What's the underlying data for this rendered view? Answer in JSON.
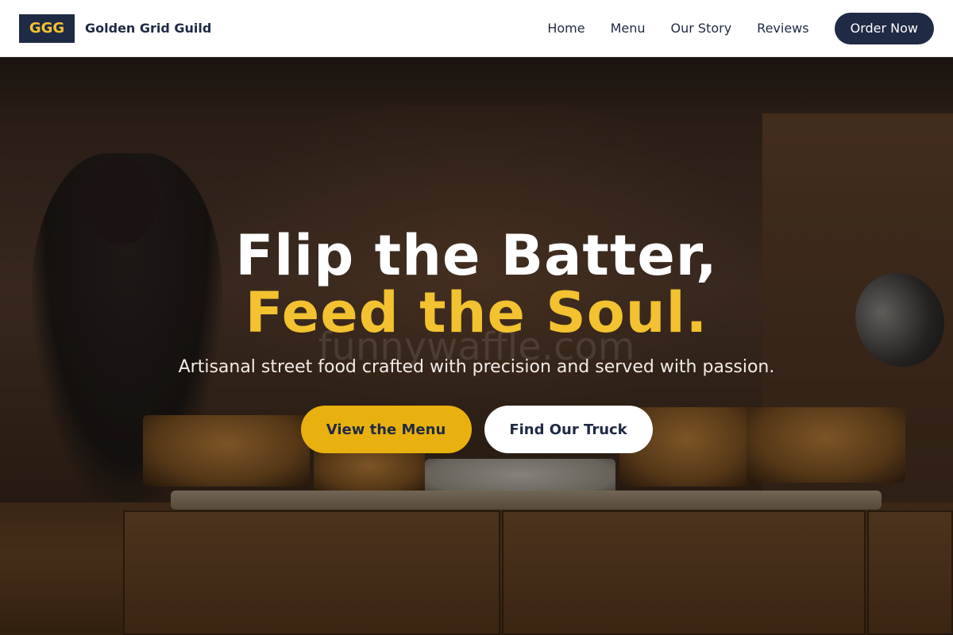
{
  "brand": {
    "badge": "GGG",
    "name": "Golden Grid Guild"
  },
  "nav": {
    "links": [
      "Home",
      "Menu",
      "Our Story",
      "Reviews"
    ],
    "cta": "Order Now"
  },
  "hero": {
    "headline_line1": "Flip the Batter,",
    "headline_line2": "Feed the Soul.",
    "subtitle": "Artisanal street food crafted with precision and served with passion.",
    "primary_cta": "View the Menu",
    "secondary_cta": "Find Our Truck",
    "watermark": "funnywaffle.com",
    "background_image": "food-truck-counter-photo"
  },
  "colors": {
    "navy": "#1f2a44",
    "gold": "#f2c230",
    "button_gold": "#e8b10f",
    "white": "#ffffff"
  }
}
